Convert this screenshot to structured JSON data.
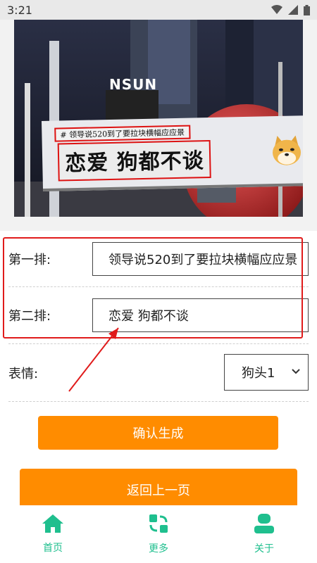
{
  "status": {
    "time": "3:21",
    "icons": [
      "wifi-icon",
      "signal-icon",
      "battery-icon"
    ]
  },
  "preview": {
    "banner_small": "# 领导说520到了要拉块横幅应应景",
    "banner_big": "恋爱 狗都不谈",
    "sign_text": "NSUN",
    "emoji": "doge-emoji"
  },
  "form": {
    "row1_label": "第一排:",
    "row1_value": "领导说520到了要拉块横幅应应景",
    "row2_label": "第二排:",
    "row2_value": "恋爱 狗都不谈",
    "row3_label": "表情:",
    "emoji_select_value": "狗头1"
  },
  "buttons": {
    "confirm": "确认生成",
    "back": "返回上一页"
  },
  "nav": {
    "items": [
      {
        "label": "首页",
        "icon": "home-icon"
      },
      {
        "label": "更多",
        "icon": "more-icon"
      },
      {
        "label": "关于",
        "icon": "person-icon"
      }
    ]
  },
  "colors": {
    "accent": "#ff8c00",
    "nav": "#1fbf8e",
    "annotation": "#e01b1b"
  }
}
